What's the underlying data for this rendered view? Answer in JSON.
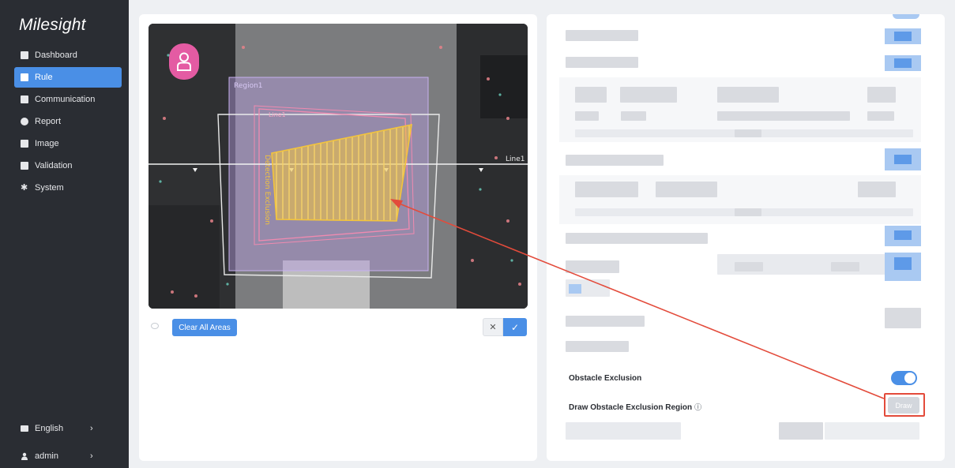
{
  "brand": {
    "logo_text": "Milesight"
  },
  "sidebar": {
    "items": [
      {
        "label": "Dashboard",
        "icon": "dashboard-icon",
        "active": false
      },
      {
        "label": "Rule",
        "icon": "rule-icon",
        "active": true
      },
      {
        "label": "Communication",
        "icon": "communication-icon",
        "active": false
      },
      {
        "label": "Report",
        "icon": "report-icon",
        "active": false
      },
      {
        "label": "Image",
        "icon": "image-icon",
        "active": false
      },
      {
        "label": "Validation",
        "icon": "validation-icon",
        "active": false
      },
      {
        "label": "System",
        "icon": "gear-icon",
        "active": false
      }
    ],
    "language": {
      "label": "English",
      "icon": "language-icon"
    },
    "user": {
      "label": "admin",
      "icon": "user-icon"
    }
  },
  "editor": {
    "overlay_labels": {
      "region": "Region1",
      "line_small": "Line1",
      "line_right": "Line1",
      "exclusion": "Detection Exclusion"
    },
    "clear_button": "Clear All Areas",
    "cancel_glyph": "✕",
    "confirm_glyph": "✓"
  },
  "settings": {
    "obstacle_exclusion_label": "Obstacle Exclusion",
    "obstacle_exclusion_enabled": true,
    "draw_region_label": "Draw Obstacle Exclusion Region",
    "info_glyph": "ⓘ",
    "draw_button": "Draw"
  },
  "colors": {
    "accent": "#4a8fe6",
    "sidebar_bg": "#2a2d33",
    "annotation": "#e34b3b",
    "exclusion_fill": "#f2c23a",
    "person_badge": "#e45ba3"
  }
}
